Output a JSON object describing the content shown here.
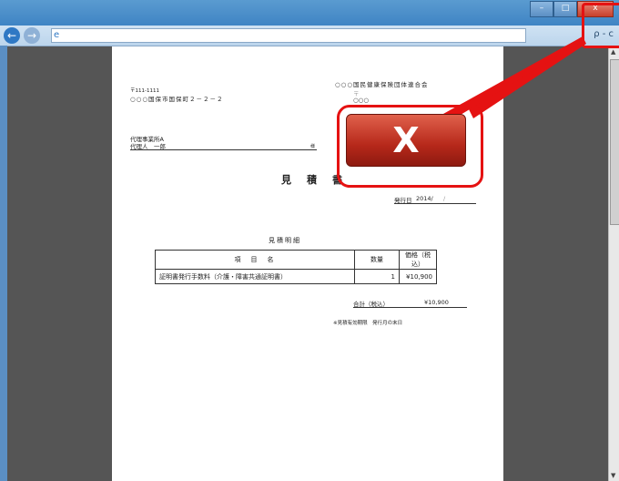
{
  "window": {
    "min_label": "–",
    "max_label": "□",
    "close_label": "x"
  },
  "nav": {
    "back_label": "←",
    "forward_label": "→",
    "ie_icon": "e",
    "tools_label": "ρ - c"
  },
  "doc": {
    "postal": "〒111-1111",
    "address": "○○○国保市国保町２－２－２",
    "issuer_name": "○○○国民健康保険団体連合会",
    "issuer_zip": "〒 ",
    "issuer_addr": "○○○",
    "recipient_office": "代理事業所A",
    "recipient_person": "代理人　一郎",
    "honorific": "様",
    "title": "見　積　書",
    "issue_date_label": "発行日",
    "issue_date": "2014/",
    "issue_date_tail": "/",
    "details_heading": "見積明細",
    "table": {
      "headers": [
        "項　目　名",
        "数量",
        "価格（税込）"
      ],
      "rows": [
        [
          "証明書発行手数料（介護・障害共通証明書）",
          "1",
          "¥10,900"
        ]
      ]
    },
    "total_label": "合計（税込）",
    "total_value": "¥10,900",
    "note": "※見積有効期限　発行月の末日"
  },
  "callout": {
    "close_symbol": "X"
  },
  "colors": {
    "accent": "#e51212",
    "titlebar": "#3f84c4"
  }
}
